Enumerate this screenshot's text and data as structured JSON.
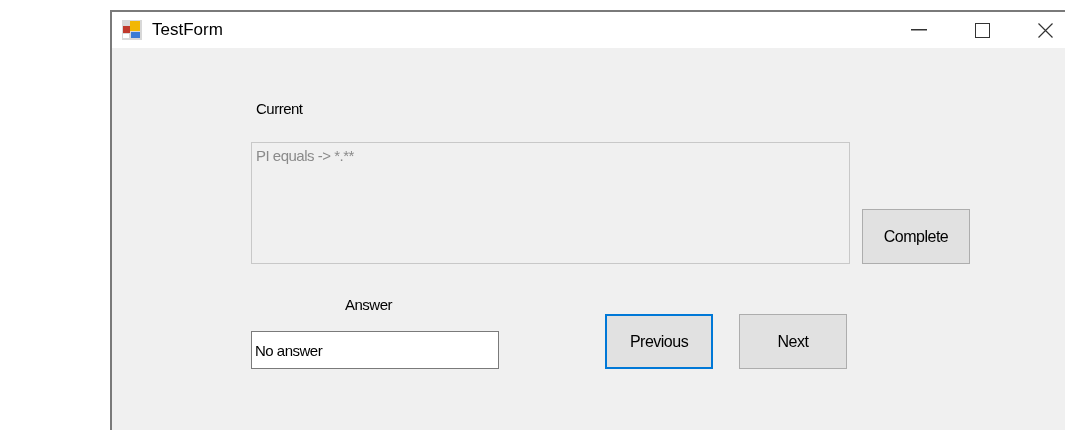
{
  "window": {
    "title": "TestForm"
  },
  "current_label": "Current",
  "question": {
    "value": "PI equals -> *.**",
    "disabled": true
  },
  "complete_button": {
    "label": "Complete",
    "focused": false
  },
  "answer_label": "Answer",
  "answer": {
    "value": "No answer"
  },
  "nav_buttons": [
    {
      "label": "Previous",
      "focused": true
    },
    {
      "label": "Next",
      "focused": false
    }
  ]
}
